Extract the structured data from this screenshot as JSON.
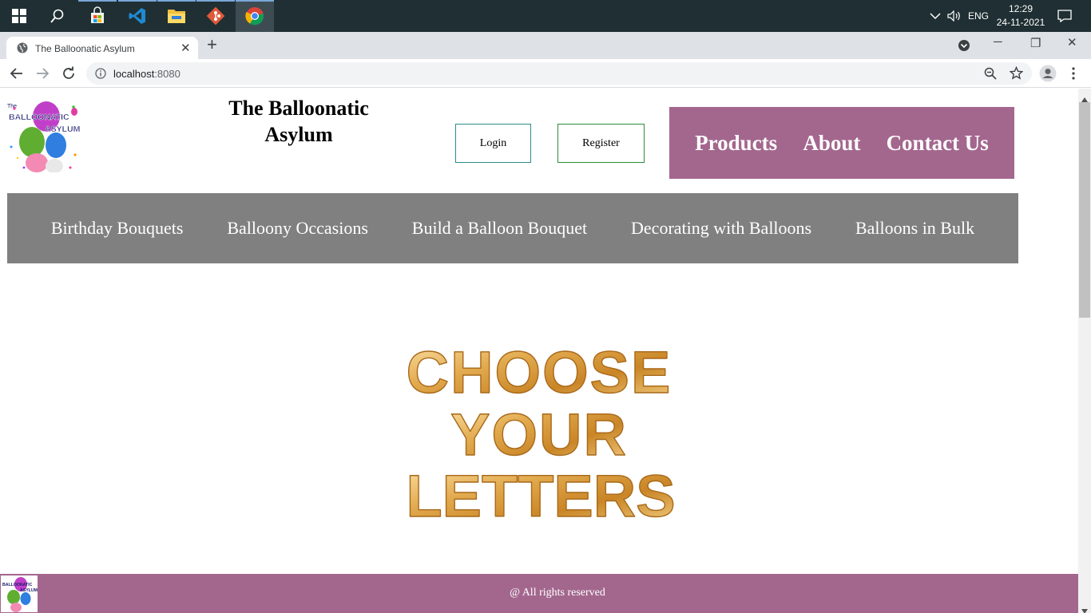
{
  "taskbar": {
    "apps": [
      "windows-start",
      "search",
      "store",
      "vscode",
      "file-explorer",
      "git",
      "chrome"
    ],
    "tray": {
      "language": "ENG",
      "time": "12:29",
      "date": "24-11-2021"
    }
  },
  "browser": {
    "tab_title": "The Balloonatic Asylum",
    "url_host": "localhost",
    "url_port": ":8080"
  },
  "page": {
    "site_title": "The Balloonatic Asylum",
    "logo_text": [
      "The",
      "BALLOONATIC",
      "ASYLUM"
    ],
    "login_label": "Login",
    "register_label": "Register",
    "top_nav": [
      "Products",
      "About",
      "Contact Us"
    ],
    "category_nav": [
      "Birthday Bouquets",
      "Balloony Occasions",
      "Build a Balloon Bouquet",
      "Decorating with Balloons",
      "Balloons in Bulk"
    ],
    "hero_lines": [
      "CHOOSE",
      "YOUR",
      "LETTERS"
    ],
    "footer_text": "@ All rights reserved"
  },
  "colors": {
    "accent": "#a3678e",
    "category_bar": "#808080",
    "taskbar": "#1f2f33"
  }
}
